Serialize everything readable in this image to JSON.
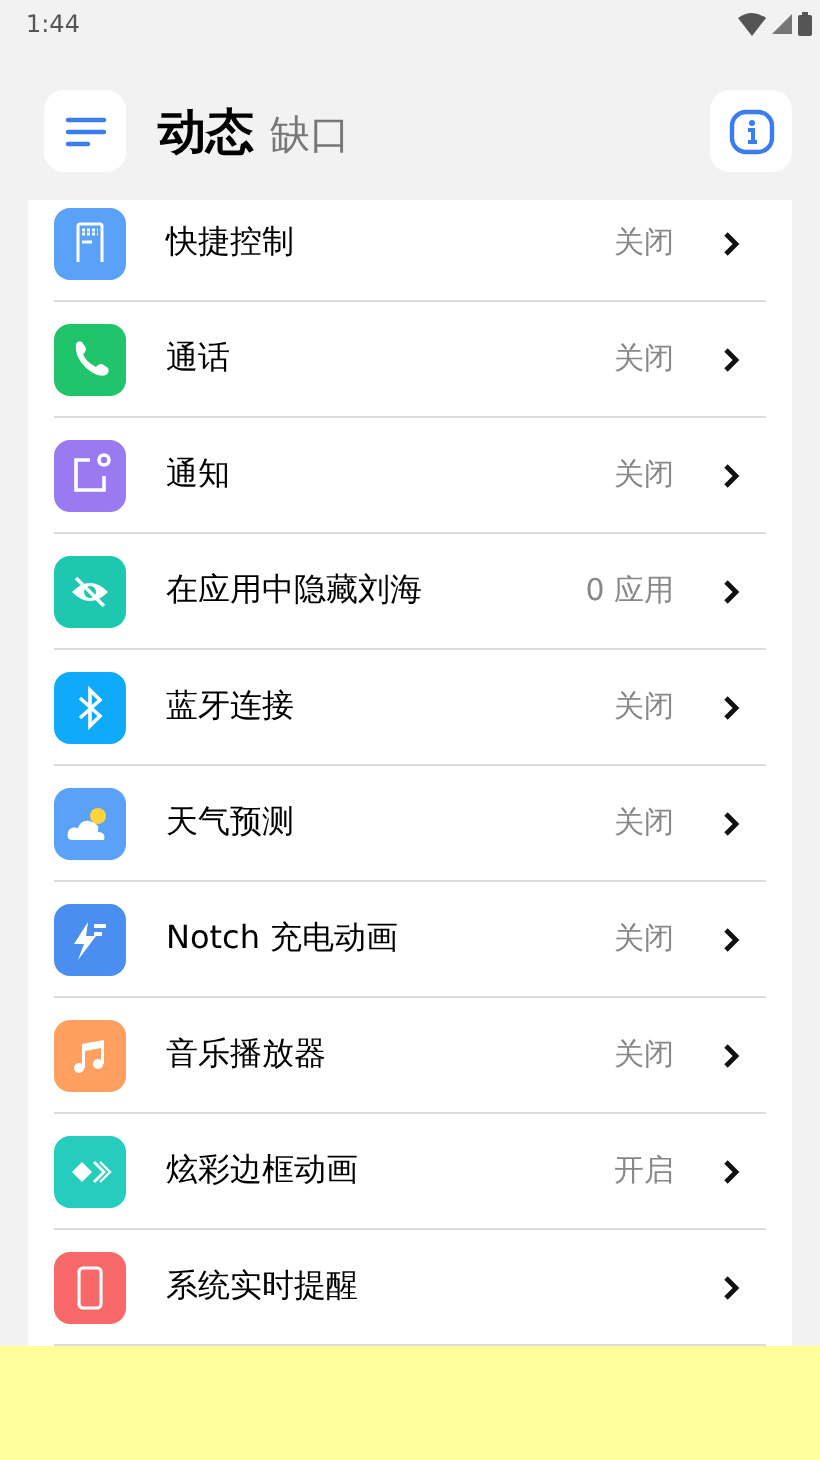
{
  "status_bar": {
    "time": "1:44"
  },
  "header": {
    "title": "动态",
    "subtitle": "缺口"
  },
  "items": [
    {
      "kind": "remote",
      "color": "#5aa2f8",
      "label": "快捷控制",
      "status": "关闭"
    },
    {
      "kind": "phone",
      "color": "#1fc46b",
      "label": "通话",
      "status": "关闭"
    },
    {
      "kind": "notify",
      "color": "#9a7af0",
      "label": "通知",
      "status": "关闭"
    },
    {
      "kind": "eye",
      "color": "#1ec8b0",
      "label": "在应用中隐藏刘海",
      "status": "0 应用"
    },
    {
      "kind": "bluetooth",
      "color": "#10aafa",
      "label": "蓝牙连接",
      "status": "关闭"
    },
    {
      "kind": "weather",
      "color": "#5aa2f8",
      "label": "天气预测",
      "status": "关闭"
    },
    {
      "kind": "bolt",
      "color": "#4a8ff0",
      "label": "Notch 充电动画",
      "status": "关闭"
    },
    {
      "kind": "music",
      "color": "#ffa060",
      "label": "音乐播放器",
      "status": "关闭"
    },
    {
      "kind": "border",
      "color": "#26ccbe",
      "label": "炫彩边框动画",
      "status": "开启"
    },
    {
      "kind": "mobile",
      "color": "#f86868",
      "label": "系统实时提醒"
    }
  ]
}
